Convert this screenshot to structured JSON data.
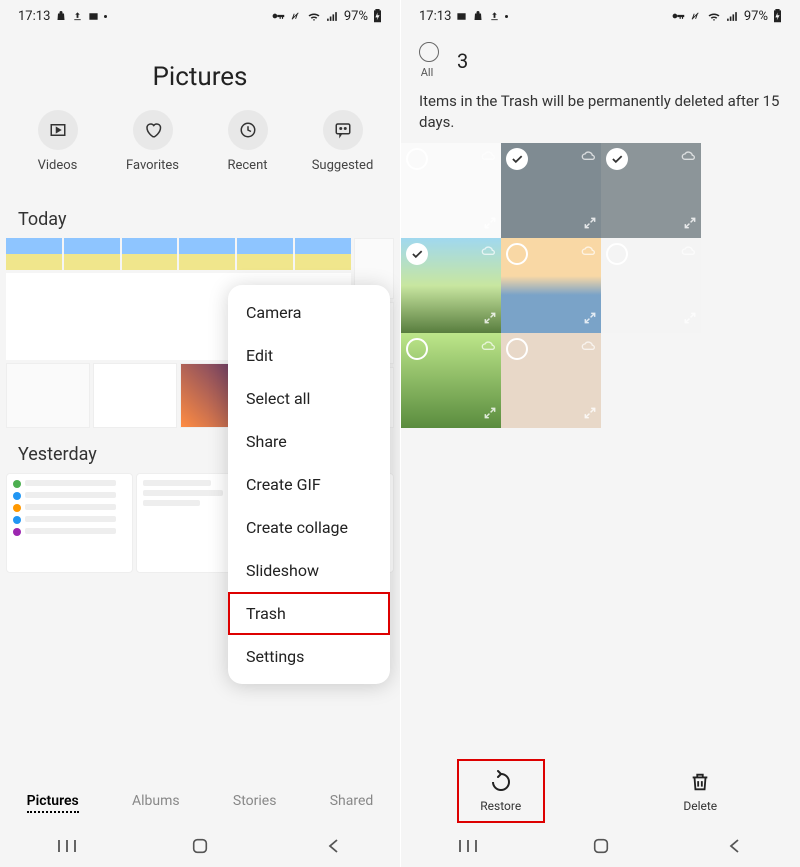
{
  "left": {
    "status": {
      "time": "17:13",
      "battery": "97%"
    },
    "title": "Pictures",
    "categories": [
      {
        "label": "Videos"
      },
      {
        "label": "Favorites"
      },
      {
        "label": "Recent"
      },
      {
        "label": "Suggested"
      }
    ],
    "sections": {
      "today": "Today",
      "yesterday": "Yesterday"
    },
    "menu": {
      "items": [
        "Camera",
        "Edit",
        "Select all",
        "Share",
        "Create GIF",
        "Create collage",
        "Slideshow",
        "Trash",
        "Settings"
      ],
      "highlighted_index": 7
    },
    "tabs": [
      "Pictures",
      "Albums",
      "Stories",
      "Shared"
    ],
    "active_tab": 0
  },
  "right": {
    "status": {
      "time": "17:13",
      "battery": "97%"
    },
    "selection": {
      "count": "3",
      "all_label": "All"
    },
    "message": "Items in the Trash will be permanently deleted after 15 days.",
    "thumbs": [
      {
        "checked": false,
        "bg": "#fafafa"
      },
      {
        "checked": true,
        "bg": "#7f8b92"
      },
      {
        "checked": true,
        "bg": "#8c9599"
      },
      {
        "checked": true,
        "bg": "linear-gradient(#a0d8ef,#c8e6a0,#587d3e)"
      },
      {
        "checked": false,
        "bg": "linear-gradient(#f9d8a5 40%,#7aa3c8 60%)"
      },
      {
        "checked": false,
        "bg": "#f4f4f4"
      },
      {
        "checked": false,
        "bg": "linear-gradient(#bde68a,#5a8c3e)"
      },
      {
        "checked": false,
        "bg": "#e8d8c8"
      }
    ],
    "actions": {
      "restore": "Restore",
      "delete": "Delete"
    },
    "highlighted_action": "restore"
  }
}
